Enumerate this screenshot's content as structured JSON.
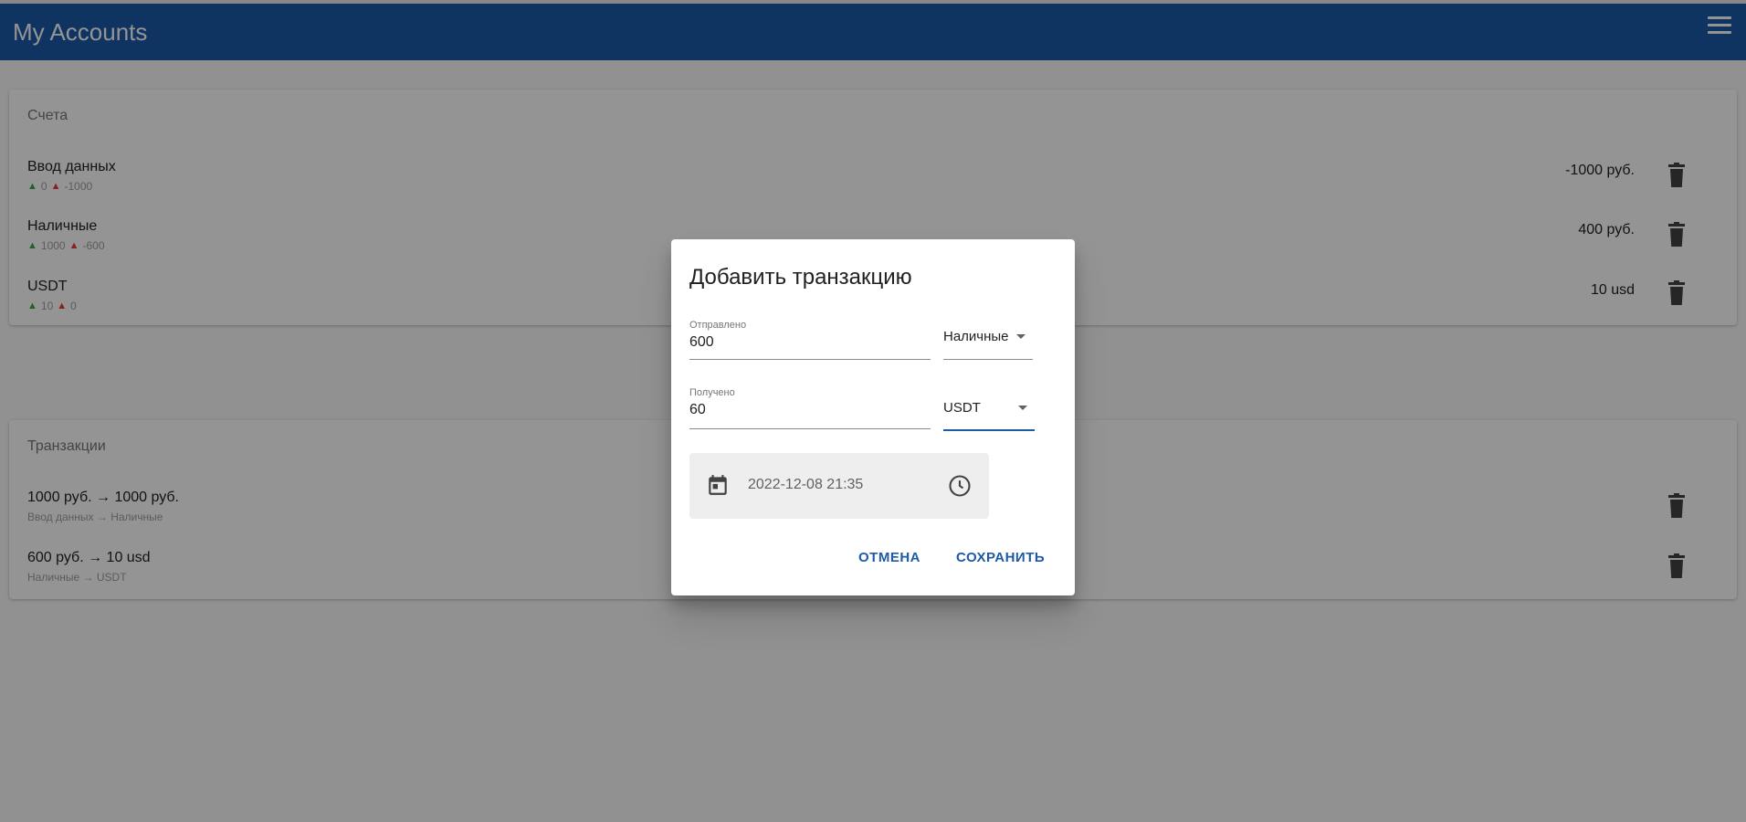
{
  "app": {
    "title": "My Accounts",
    "menu_icon": "menu-icon"
  },
  "accounts": {
    "title": "Счета",
    "items": [
      {
        "name": "Ввод данных",
        "in": "0",
        "out": "-1000",
        "amount": "-1000 руб."
      },
      {
        "name": "Наличные",
        "in": "1000",
        "out": "-600",
        "amount": "400 руб."
      },
      {
        "name": "USDT",
        "in": "10",
        "out": "0",
        "amount": "10 usd"
      }
    ]
  },
  "transactions": {
    "title": "Транзакции",
    "items": [
      {
        "summary": "1000 руб. → 1000 руб.",
        "route": "Ввод данных → Наличные"
      },
      {
        "summary": "600 руб. → 10 usd",
        "route": "Наличные → USDT"
      }
    ]
  },
  "dialog": {
    "title": "Добавить транзакцию",
    "sent": {
      "label": "Отправлено",
      "value": "600",
      "account": "Наличные"
    },
    "received": {
      "label": "Получено",
      "value": "60",
      "account": "USDT"
    },
    "datetime": "2022-12-08 21:35",
    "cancel_label": "ОТМЕНА",
    "save_label": "СОХРАНИТЬ"
  },
  "colors": {
    "primary": "#1d5aa8",
    "up": "#43a047",
    "down": "#e53935"
  }
}
